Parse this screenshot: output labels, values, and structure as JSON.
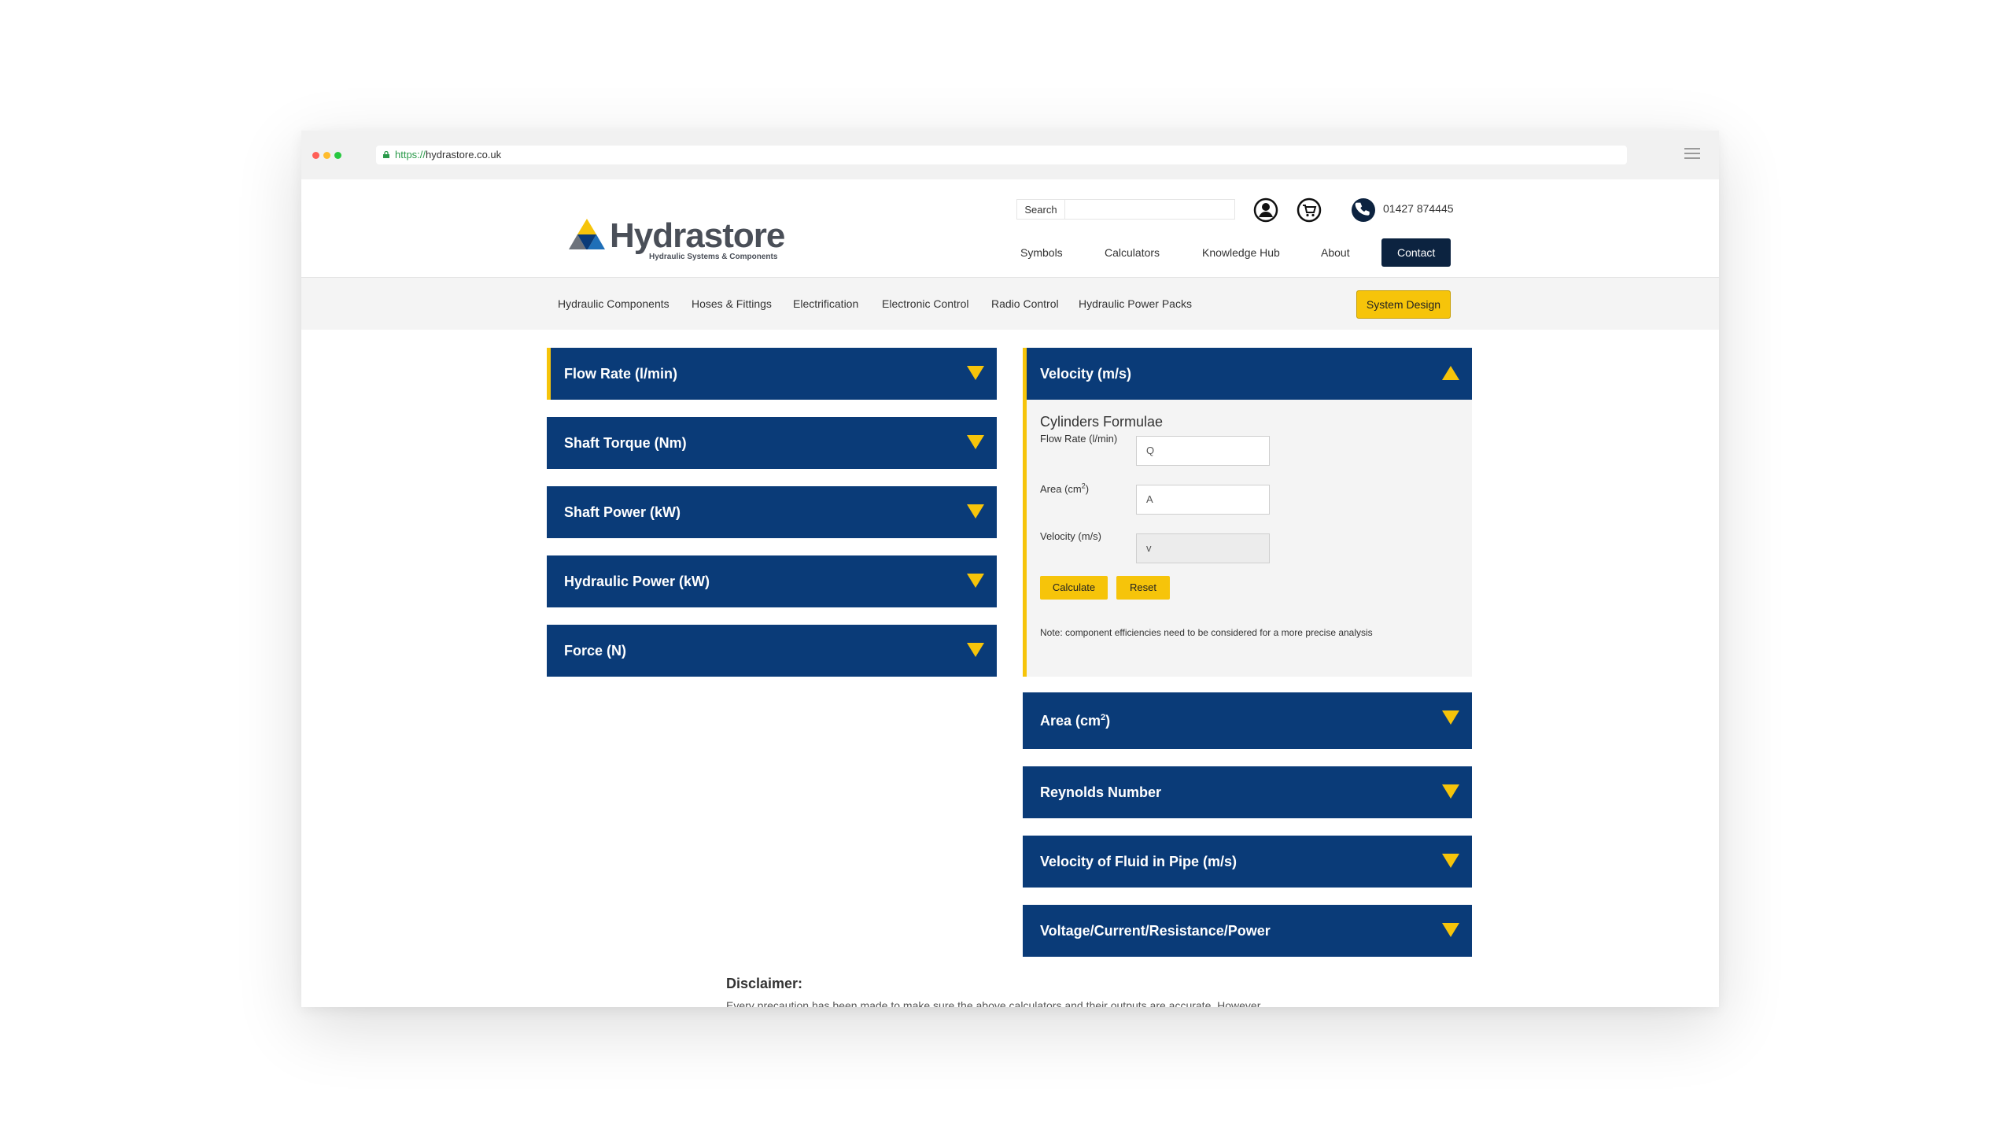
{
  "browser": {
    "url_protocol": "https://",
    "url_host": "hydrastore.co.uk",
    "traffic_lights": [
      "#ff5f57",
      "#febc2e",
      "#28c840"
    ]
  },
  "header": {
    "logo_text": "Hydrastore",
    "logo_subtitle": "Hydraulic Systems & Components",
    "search_label": "Search",
    "search_value": "",
    "phone": "01427 874445",
    "icons": [
      "account-icon",
      "cart-icon",
      "phone-icon"
    ],
    "nav": [
      "Symbols",
      "Calculators",
      "Knowledge Hub",
      "About",
      "Contact"
    ]
  },
  "subnav": {
    "items": [
      "Hydraulic Components",
      "Hoses & Fittings",
      "Electrification",
      "Electronic Control",
      "Radio Control",
      "Hydraulic Power Packs"
    ],
    "cta": "System Design"
  },
  "left_accordions": [
    "Flow Rate (l/min)",
    "Shaft Torque (Nm)",
    "Shaft Power (kW)",
    "Hydraulic Power (kW)",
    "Force (N)"
  ],
  "right_accordions": {
    "open": {
      "title": "Velocity (m/s)",
      "panel_title": "Cylinders Formulae",
      "fields": [
        {
          "label": "Flow Rate (l/min)",
          "placeholder": "Q"
        },
        {
          "label_main": "Area (cm",
          "label_sup": "2",
          "label_end": ")",
          "placeholder": "A"
        },
        {
          "label": "Velocity (m/s)",
          "placeholder": "v"
        }
      ],
      "calculate": "Calculate",
      "reset": "Reset",
      "note": "Note: component efficiencies need to be considered for a more precise analysis"
    },
    "area": {
      "main": "Area (cm",
      "sup": "2",
      "end": ")"
    },
    "others": [
      "Reynolds Number",
      "Velocity of Fluid in Pipe (m/s)",
      "Voltage/Current/Resistance/Power"
    ]
  },
  "disclaimer": {
    "title": "Disclaimer:",
    "text": "Every precaution has been made to make sure the above calculators and their outputs are accurate. However,"
  },
  "colors": {
    "brand_navy": "#0a3b78",
    "accent_yellow": "#f6c40a",
    "contact_bg": "#0c2340"
  }
}
